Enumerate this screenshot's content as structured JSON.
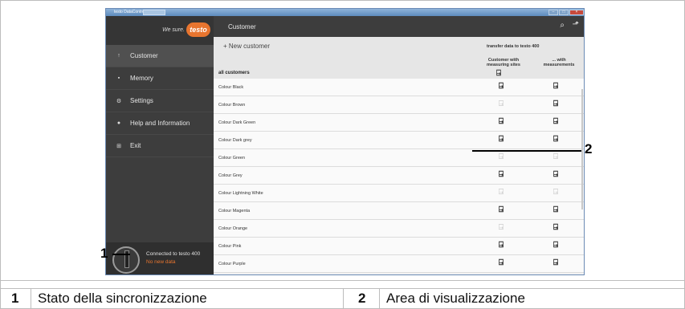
{
  "window": {
    "title": "testo DataControl",
    "tab": ""
  },
  "brand": {
    "slogan": "We sure.",
    "logo": "testo"
  },
  "sidebar": {
    "items": [
      {
        "label": "Customer",
        "icon": "person-icon",
        "glyph": "↑",
        "active": true
      },
      {
        "label": "Memory",
        "icon": "memory-icon",
        "glyph": "▪",
        "active": false
      },
      {
        "label": "Settings",
        "icon": "gear-icon",
        "glyph": "⚙",
        "active": false
      },
      {
        "label": "Help and Information",
        "icon": "help-icon",
        "glyph": "●",
        "active": false
      },
      {
        "label": "Exit",
        "icon": "exit-icon",
        "glyph": "⊞",
        "active": false
      }
    ],
    "connection": {
      "status": "Connected to testo 400",
      "sub": "No new data"
    }
  },
  "header": {
    "title": "Customer",
    "search_glyph": "⌕",
    "export_glyph": "⬏"
  },
  "toolbar": {
    "new_customer": "+ New customer",
    "transfer_label": "transfer data to testo 400",
    "col1": "Customer with measuring sites",
    "col2": "... with measurements",
    "all_customers": "all customers",
    "transfer_glyph": "⍈"
  },
  "customers": [
    {
      "name": "Colour Black",
      "c1": true,
      "c2": true
    },
    {
      "name": "Colour Brown",
      "c1": false,
      "c2": true
    },
    {
      "name": "Colour Dark Green",
      "c1": true,
      "c2": true
    },
    {
      "name": "Colour Dark grey",
      "c1": true,
      "c2": true
    },
    {
      "name": "Colour Green",
      "c1": false,
      "c2": false
    },
    {
      "name": "Colour Grey",
      "c1": true,
      "c2": true
    },
    {
      "name": "Colour Lightning White",
      "c1": false,
      "c2": false
    },
    {
      "name": "Colour Magenta",
      "c1": true,
      "c2": true
    },
    {
      "name": "Colour Orange",
      "c1": false,
      "c2": true
    },
    {
      "name": "Colour Pink",
      "c1": true,
      "c2": true
    },
    {
      "name": "Colour Purple",
      "c1": true,
      "c2": true
    }
  ],
  "callouts": {
    "one": "1",
    "two": "2"
  },
  "legend": [
    {
      "num": "1",
      "text": "Stato della sincronizzazione"
    },
    {
      "num": "2",
      "text": "Area di visualizzazione"
    }
  ]
}
